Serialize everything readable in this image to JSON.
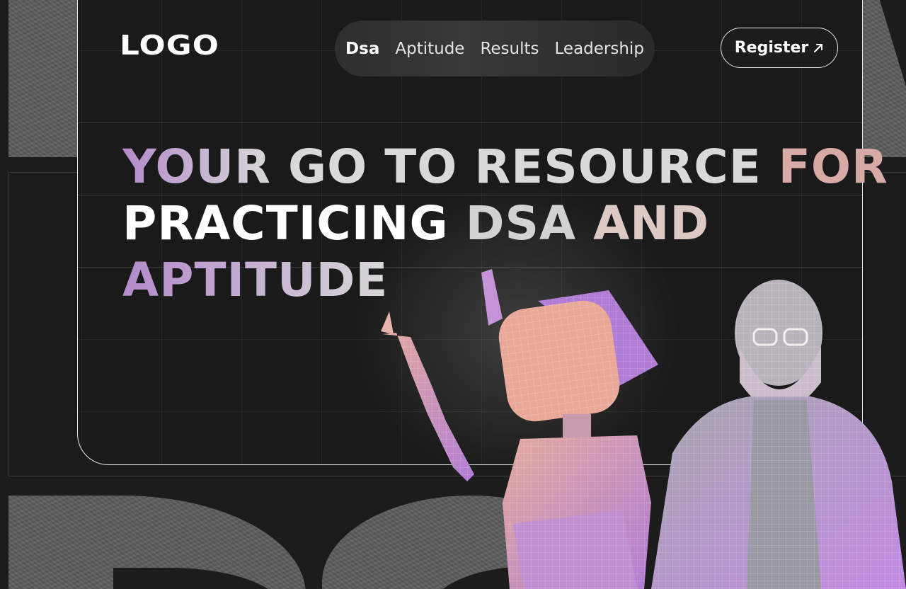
{
  "header": {
    "logo": "LOGO",
    "nav": [
      {
        "label": "Dsa",
        "active": true
      },
      {
        "label": "Aptitude",
        "active": false
      },
      {
        "label": "Results",
        "active": false
      },
      {
        "label": "Leadership",
        "active": false
      }
    ],
    "register_label": "Register",
    "register_icon": "arrow-up-right-icon"
  },
  "hero": {
    "line1": {
      "w1": "YOUR",
      "w2": "GO TO RESOURCE",
      "w3": "FOR"
    },
    "line2": {
      "w1": "PRACTICING",
      "w2": "DSA",
      "w3": "AND"
    },
    "line3": {
      "w1": "APTITUDE"
    }
  },
  "illustration": {
    "subjects": [
      "robot-figure",
      "bearded-man-figure"
    ],
    "colors": {
      "purple": "#b07cd6",
      "peach": "#e0a59a",
      "grey": "#a9a9b3"
    }
  },
  "colors": {
    "background": "#1c1c1c",
    "accent_purple": "#b88ccc",
    "accent_pink": "#d7aaa6",
    "text": "#ffffff"
  }
}
